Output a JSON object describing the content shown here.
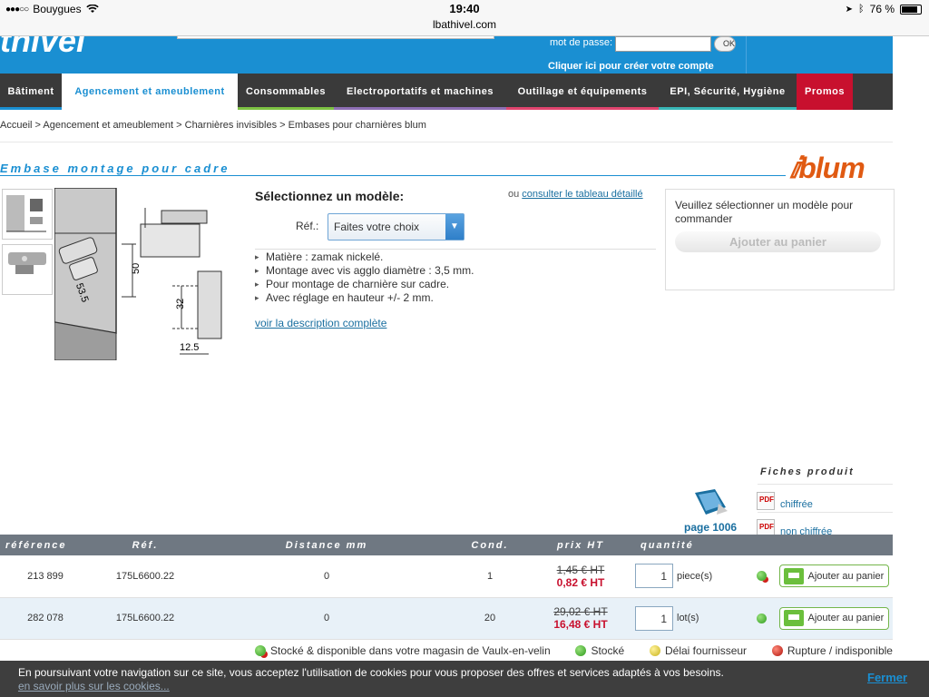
{
  "statusbar": {
    "carrier": "Bouygues",
    "time": "19:40",
    "url": "lbathivel.com",
    "battery": "76 %"
  },
  "header": {
    "logo_text": "thivel",
    "password_label": "mot de passe:",
    "ok_label": "OK",
    "create_account": "Cliquer ici pour créer votre compte"
  },
  "nav": {
    "items": [
      {
        "label": "Bâtiment",
        "color": "#1a8fd2"
      },
      {
        "label": "Agencement et ameublement",
        "color": "#7dc243"
      },
      {
        "label": "Consommables",
        "color": "#7dc243"
      },
      {
        "label": "Electroportatifs et machines",
        "color": "#8e6fb5"
      },
      {
        "label": "Outillage et équipements",
        "color": "#e0446e"
      },
      {
        "label": "EPI, Sécurité, Hygiène",
        "color": "#39b7b7"
      },
      {
        "label": "Promos",
        "color": "#c8102e"
      }
    ],
    "active_index": 1
  },
  "breadcrumb": "Accueil  > Agencement et ameublement > Charnières invisibles > Embases pour charnières blum",
  "product": {
    "title": "Embase montage pour cadre",
    "brand": "blum",
    "diagram_labels": {
      "a": "50",
      "b": "53.5",
      "c": "32",
      "d": "12.5"
    },
    "select_title": "Sélectionnez un modèle:",
    "or_text": "ou ",
    "table_link": "consulter le tableau détaillé",
    "ref_label": "Réf.:",
    "select_value": "Faites votre choix",
    "features": [
      "Matière : zamak nickelé.",
      "Montage avec vis agglo diamètre : 3,5 mm.",
      "Pour montage de charnière sur cadre.",
      "Avec réglage en hauteur +/- 2 mm."
    ],
    "desc_link": "voir la description complète"
  },
  "order": {
    "message": "Veuillez sélectionner un modèle pour commander",
    "button": "Ajouter au panier"
  },
  "fiches": {
    "title": "Fiches produit",
    "items": [
      "chiffrée",
      "non chiffrée"
    ]
  },
  "catalog": {
    "page": "page 1006"
  },
  "table": {
    "headers": [
      "référence",
      "Réf.",
      "Distance mm",
      "Cond.",
      "prix HT",
      "quantité"
    ],
    "rows": [
      {
        "reference": "213 899",
        "ref": "175L6600.22",
        "distance": "0",
        "cond": "1",
        "old_price": "1,45 € HT",
        "new_price": "0,82 € HT",
        "qty": "1",
        "unit": "piece(s)",
        "stock": "Stocké & disponible",
        "button": "Ajouter au panier"
      },
      {
        "reference": "282 078",
        "ref": "175L6600.22",
        "distance": "0",
        "cond": "20",
        "old_price": "29,02 € HT",
        "new_price": "16,48 € HT",
        "qty": "1",
        "unit": "lot(s)",
        "stock": "Stocké",
        "button": "Ajouter au panier"
      }
    ]
  },
  "legend": [
    {
      "label": "Stocké & disponible dans votre magasin de Vaulx-en-velin",
      "color": "#3aa02a"
    },
    {
      "label": "Stocké",
      "color": "#3aa02a"
    },
    {
      "label": "Délai fournisseur",
      "color": "#e6d23a"
    },
    {
      "label": "Rupture / indisponible",
      "color": "#d0201a"
    }
  ],
  "cookie": {
    "text": "En poursuivant votre navigation sur ce site, vous acceptez l'utilisation de cookies pour vous proposer des offres et services adaptés à vos besoins.",
    "more": "en savoir plus sur les cookies...",
    "close": "Fermer"
  }
}
